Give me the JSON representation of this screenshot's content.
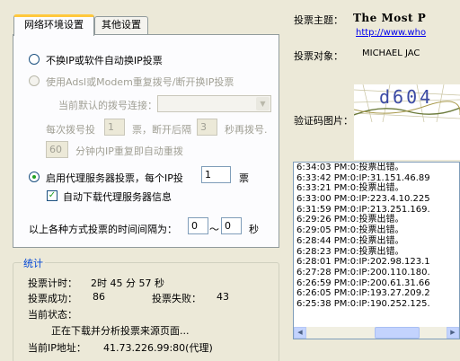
{
  "tabs": {
    "network": "网络环境设置",
    "other": "其他设置"
  },
  "network": {
    "opt_no_change_ip": "不换IP或软件自动换IP投票",
    "opt_adsl": "使用Adsl或Modem重复拨号/断开换IP投票",
    "current_dial_label": "当前默认的拨号连接：",
    "dial_prefix": "每次拨号投",
    "dial_votes_value": "1",
    "dial_middle": "票，断开后隔",
    "dial_seconds_value": "3",
    "dial_suffix": "秒再拨号.",
    "redial_minutes_value": "60",
    "redial_suffix": "分钟内IP重复即自动重拨",
    "opt_proxy_prefix": "启用代理服务器投票，每个IP投",
    "proxy_votes_value": "1",
    "proxy_suffix": "票",
    "auto_download_label": "自动下载代理服务器信息",
    "interval_label": "以上各种方式投票的时间间隔为：",
    "interval_from": "0",
    "interval_sep": "～",
    "interval_to": "0",
    "interval_unit": "秒"
  },
  "stats": {
    "group_title": "统计",
    "timer_label": "投票计时：",
    "timer_value": "2时 45 分 57 秒",
    "success_label": "投票成功：",
    "success_value": "86",
    "fail_label": "投票失败：",
    "fail_value": "43",
    "status_label": "当前状态：",
    "status_value": "正在下载并分析投票来源页面...",
    "ip_label": "当前IP地址：",
    "ip_value": "41.73.226.99:80(代理)"
  },
  "vote": {
    "subject_label": "投票主题：",
    "subject_value": "The Most P",
    "url": "http://www.who",
    "target_label": "投票对象：",
    "target_value": "MICHAEL JAC",
    "captcha_label": "验证码图片：",
    "captcha_text": "d604"
  },
  "log": [
    "6:34:03 PM:0:投票出错。",
    "6:33:42 PM:0:IP:31.151.46.89",
    "6:33:21 PM:0:投票出错。",
    "6:33:00 PM:0:IP:223.4.10.225",
    "6:31:59 PM:0:IP:213.251.169.",
    "6:29:26 PM:0:投票出错。",
    "6:29:05 PM:0:投票出错。",
    "6:28:44 PM:0:投票出错。",
    "6:28:23 PM:0:投票出错。",
    "6:28:01 PM:0:IP:202.98.123.1",
    "6:27:28 PM:0:IP:200.110.180.",
    "6:26:59 PM:0:IP:200.61.31.66",
    "6:26:05 PM:0:IP:193.27.209.2",
    "6:25:38 PM:0:IP:190.252.125."
  ],
  "colors": {
    "window_bg": "#ece9d8",
    "accent_tab": "#ffc83c",
    "group_title": "#0046d5",
    "link": "#0000ee"
  }
}
